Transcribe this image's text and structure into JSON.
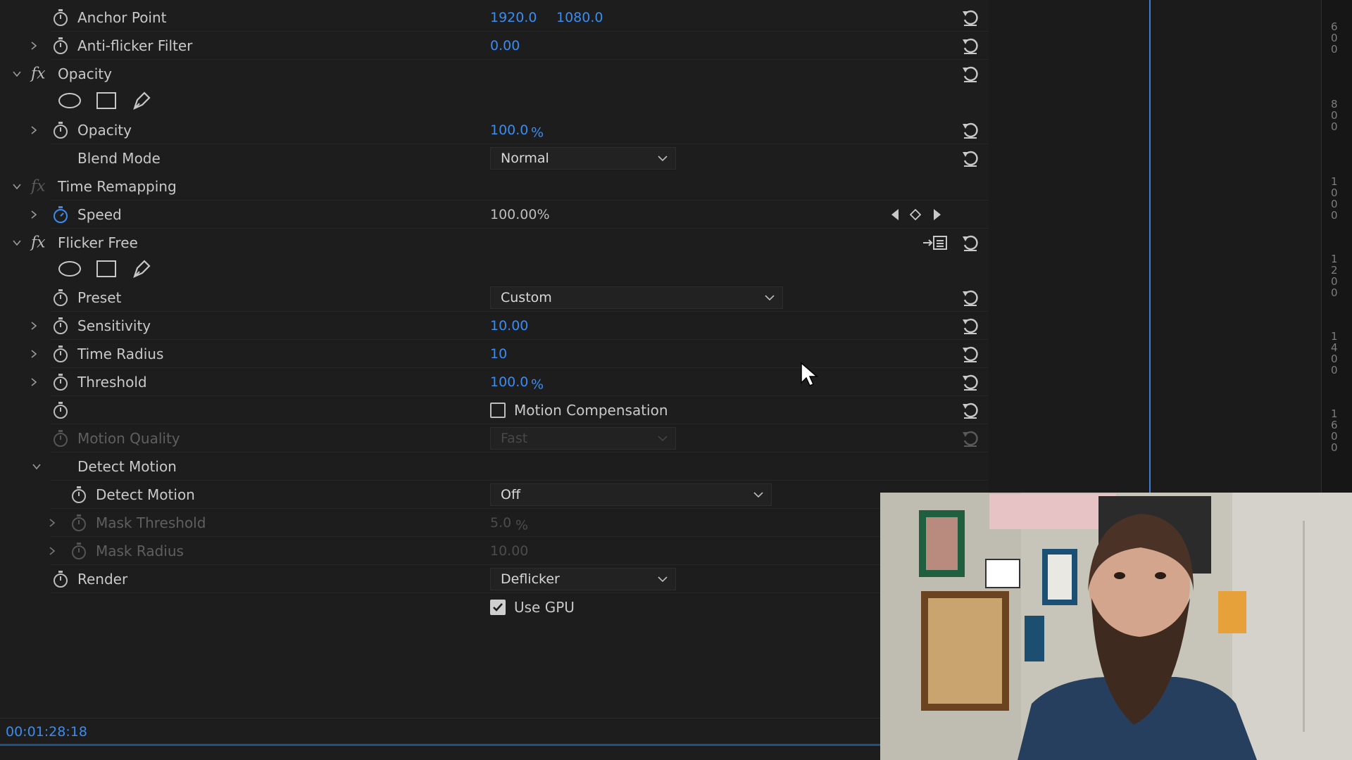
{
  "properties": {
    "anchor_point": {
      "label": "Anchor Point",
      "x": "1920.0",
      "y": "1080.0"
    },
    "anti_flicker": {
      "label": "Anti-flicker Filter",
      "value": "0.00"
    },
    "opacity_effect": {
      "label": "Opacity"
    },
    "opacity": {
      "label": "Opacity",
      "value": "100.0",
      "unit": "%"
    },
    "blend_mode": {
      "label": "Blend Mode",
      "value": "Normal"
    },
    "time_remapping": {
      "label": "Time Remapping"
    },
    "speed": {
      "label": "Speed",
      "value": "100.00%"
    },
    "flicker_free": {
      "label": "Flicker Free"
    },
    "preset": {
      "label": "Preset",
      "value": "Custom"
    },
    "sensitivity": {
      "label": "Sensitivity",
      "value": "10.00"
    },
    "time_radius": {
      "label": "Time Radius",
      "value": "10"
    },
    "threshold": {
      "label": "Threshold",
      "value": "100.0",
      "unit": "%"
    },
    "motion_compensation": {
      "label": "Motion Compensation",
      "checked": false
    },
    "motion_quality": {
      "label": "Motion Quality",
      "value": "Fast"
    },
    "detect_motion_group": {
      "label": "Detect Motion"
    },
    "detect_motion": {
      "label": "Detect Motion",
      "value": "Off"
    },
    "mask_threshold": {
      "label": "Mask Threshold",
      "value": "5.0",
      "unit": "%"
    },
    "mask_radius": {
      "label": "Mask Radius",
      "value": "10.00"
    },
    "render": {
      "label": "Render",
      "value": "Deflicker"
    },
    "use_gpu": {
      "label": "Use GPU",
      "checked": true
    }
  },
  "footer": {
    "timecode": "00:01:28:18"
  },
  "ruler": {
    "labels": [
      "600",
      "800",
      "1000",
      "1200",
      "1400",
      "1600"
    ]
  },
  "colors": {
    "accent_blue": "#3b8cf0",
    "panel_bg": "#1d1d1d",
    "playhead": "#3b7fd8"
  }
}
